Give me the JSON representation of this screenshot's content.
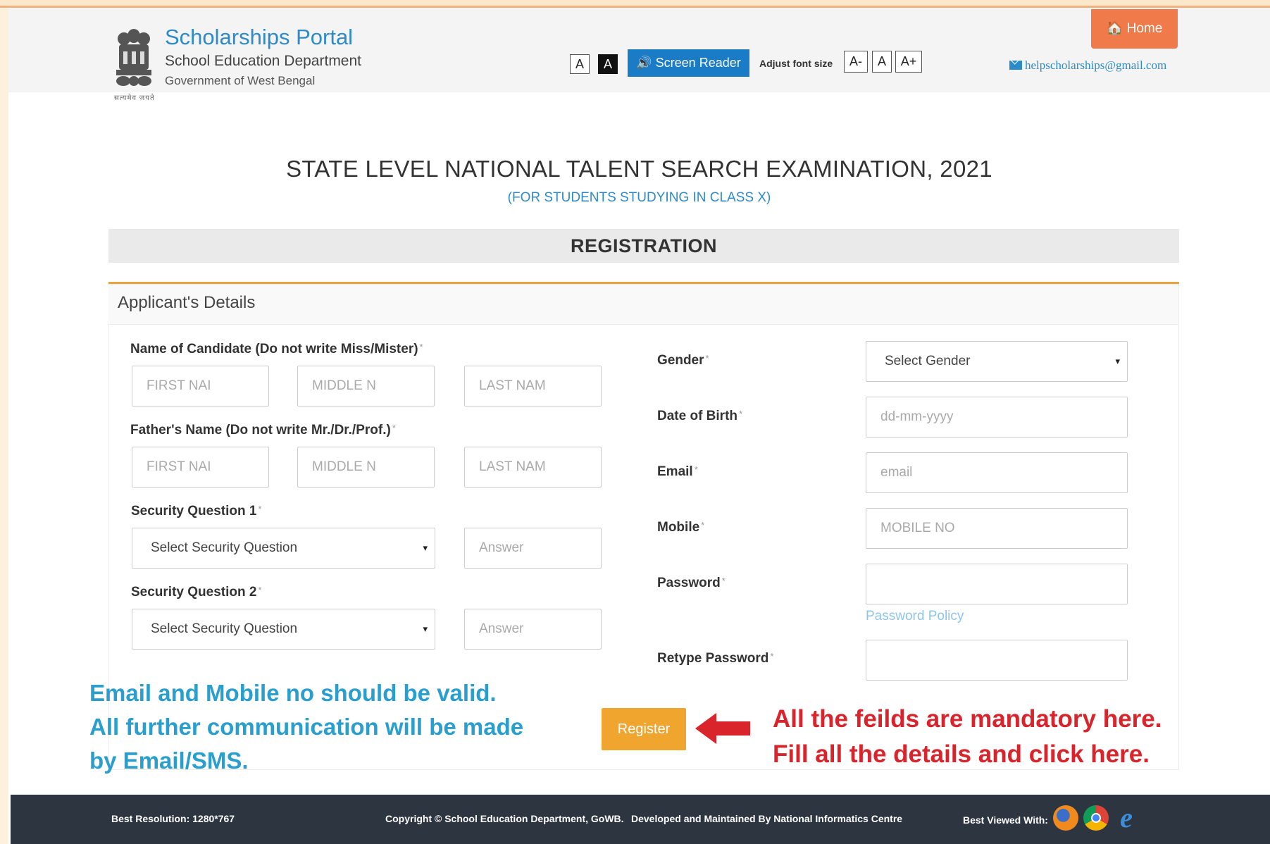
{
  "header": {
    "portal_title": "Scholarships Portal",
    "department": "School Education Department",
    "government": "Government of West Bengal",
    "emblem_caption": "सत्यमेव जयते",
    "contrast_light": "A",
    "contrast_dark": "A",
    "screen_reader": "🔊 Screen Reader",
    "adjust_font_label": "Adjust font size",
    "font_decrease": "A-",
    "font_normal": "A",
    "font_increase": "A+",
    "home": "🏠 Home",
    "help_email": "helpscholarships@gmail.com"
  },
  "page": {
    "title": "STATE LEVEL NATIONAL TALENT SEARCH EXAMINATION, 2021",
    "subtitle": "(FOR STUDENTS STUDYING IN CLASS X)",
    "section_title": "REGISTRATION",
    "panel_title": "Applicant's Details"
  },
  "form": {
    "candidate_name_label": "Name of Candidate (Do not write Miss/Mister)",
    "father_name_label": "Father's Name (Do not write Mr./Dr./Prof.)",
    "security_q1_label": "Security Question 1",
    "security_q2_label": "Security Question 2",
    "gender_label": "Gender",
    "dob_label": "Date of Birth",
    "email_label": "Email",
    "mobile_label": "Mobile",
    "password_label": "Password",
    "retype_password_label": "Retype Password",
    "required_mark": "*",
    "first_name_placeholder": "FIRST NAI",
    "middle_name_placeholder": "MIDDLE N",
    "last_name_placeholder": "LAST NAM",
    "security_select_value": "Select Security Question",
    "answer_placeholder": "Answer",
    "gender_select_value": "Select Gender",
    "dob_placeholder": "dd-mm-yyyy",
    "email_placeholder": "email",
    "mobile_placeholder": "MOBILE NO",
    "password_policy_link": "Password Policy",
    "register_button": "Register",
    "caret": "▾"
  },
  "annotations": {
    "blue_line1": "Email and Mobile no should be valid.",
    "blue_line2": "All further communication will be made",
    "blue_line3": "by Email/SMS.",
    "red_line1": "All the feilds are mandatory here.",
    "red_line2": "Fill all the details and click here."
  },
  "footer": {
    "resolution": "Best Resolution: 1280*767",
    "copyright": "Copyright © School Education Department, GoWB.",
    "developed_by": "Developed and Maintained By National Informatics Centre",
    "best_viewed": "Best Viewed With:"
  },
  "colors": {
    "accent_blue": "#2e8bc9",
    "home_orange": "#f07a49",
    "register_orange": "#f0a52f",
    "annotation_red": "#d9242c",
    "annotation_blue": "#2a9fce",
    "footer_dark": "#2d3540"
  },
  "icons": [
    "state-emblem-icon",
    "speaker-icon",
    "home-icon",
    "envelope-icon",
    "red-arrow-icon",
    "firefox-icon",
    "chrome-icon",
    "ie-icon"
  ]
}
